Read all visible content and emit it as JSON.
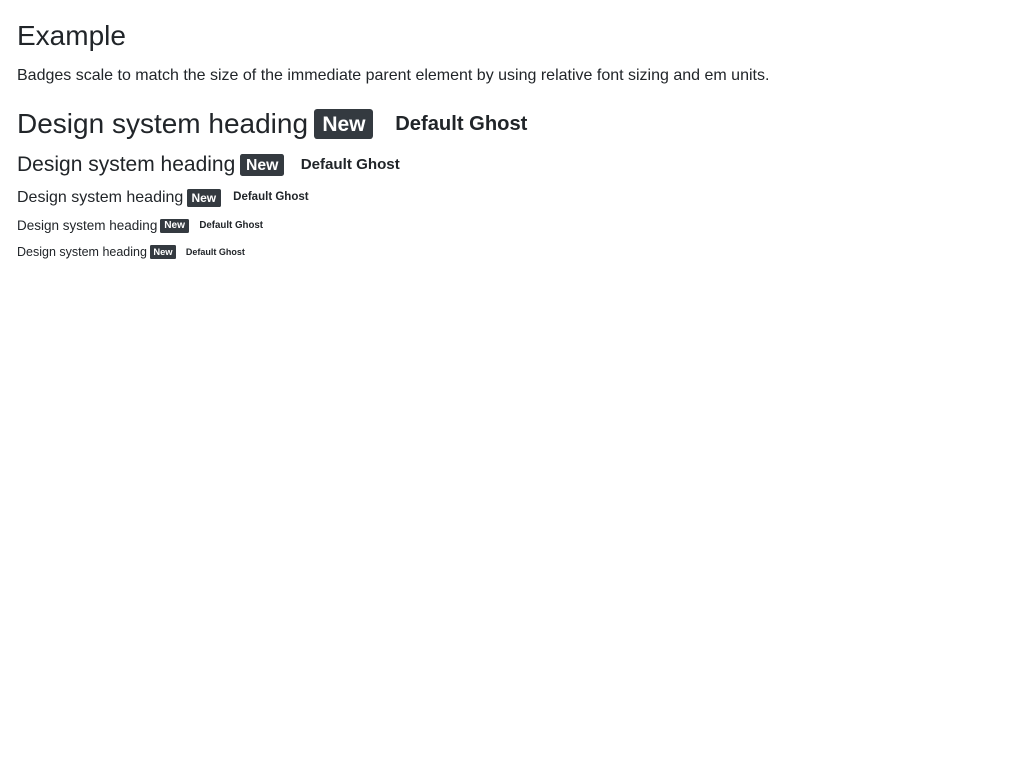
{
  "example": {
    "title": "Example",
    "description": "Badges scale to match the size of the immediate parent element by using relative font sizing and em units."
  },
  "headings": [
    {
      "text": "Design system heading",
      "badge": "New",
      "ghost": "Default Ghost"
    },
    {
      "text": "Design system heading",
      "badge": "New",
      "ghost": "Default Ghost"
    },
    {
      "text": "Design system heading",
      "badge": "New",
      "ghost": "Default Ghost"
    },
    {
      "text": "Design system heading",
      "badge": "New",
      "ghost": "Default Ghost"
    },
    {
      "text": "Design system heading",
      "badge": "New",
      "ghost": "Default Ghost"
    }
  ],
  "colors": {
    "text": "#212529",
    "badge_bg": "#343a40",
    "badge_text": "#ffffff",
    "background": "#ffffff"
  }
}
